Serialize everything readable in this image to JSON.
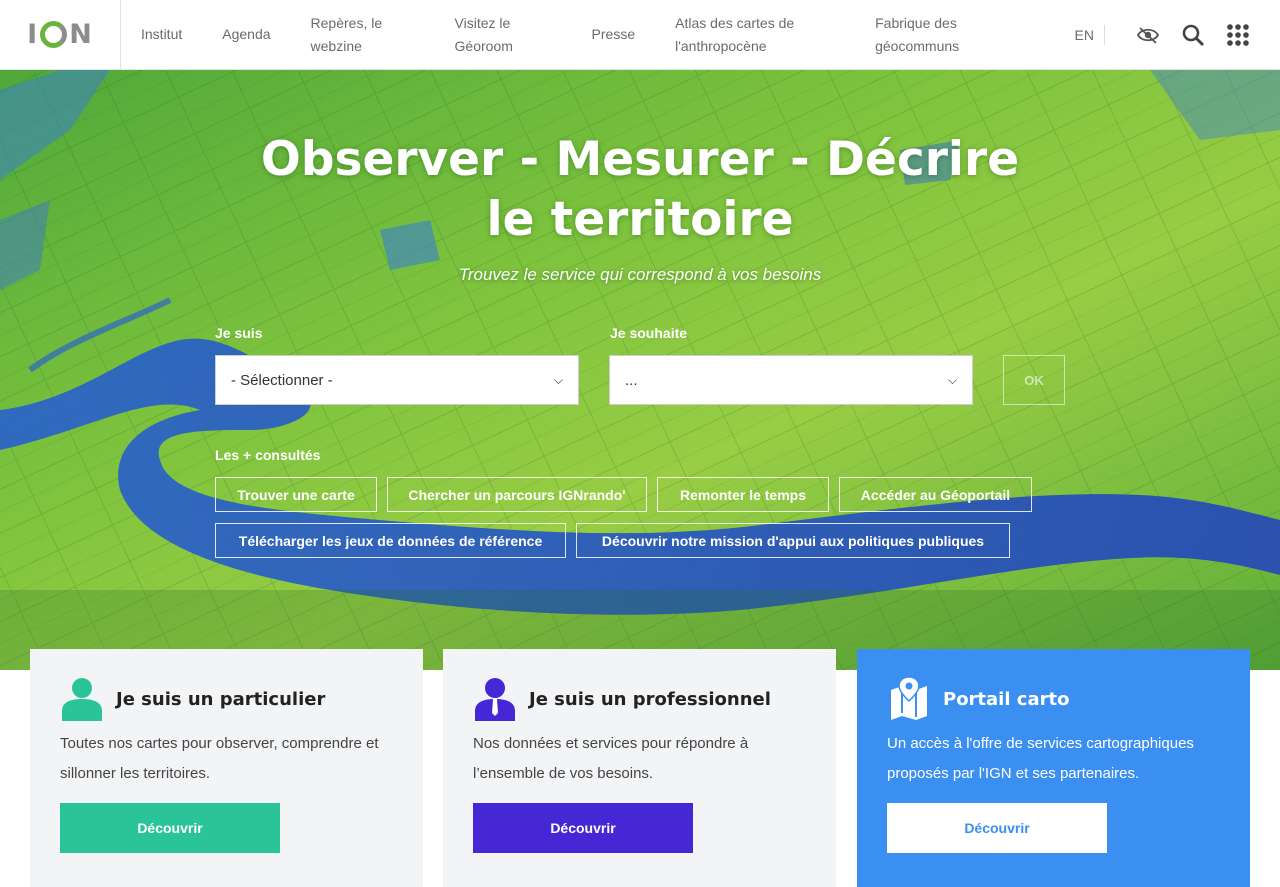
{
  "header": {
    "logo_text": "IGN",
    "nav": [
      {
        "label": "Institut"
      },
      {
        "label": "Agenda"
      },
      {
        "label": "Repères, le webzine"
      },
      {
        "label": "Visitez le Géoroom"
      },
      {
        "label": "Presse"
      },
      {
        "label": "Atlas des cartes de l'anthropocène"
      },
      {
        "label": "Fabrique des géocommuns"
      }
    ],
    "lang": "EN",
    "icons": [
      "accessibility-eye-icon",
      "search-icon",
      "apps-grid-icon"
    ]
  },
  "hero": {
    "title_line1": "Observer - Mesurer - Décrire",
    "title_line2": "le territoire",
    "subtitle": "Trouvez le service qui correspond à vos besoins",
    "form": {
      "je_suis_label": "Je suis",
      "je_suis_value": "- Sélectionner -",
      "je_souhaite_label": "Je souhaite",
      "je_souhaite_value": "...",
      "ok_label": "OK"
    },
    "popular": {
      "label": "Les + consultés",
      "chips": [
        "Trouver une carte",
        "Chercher un parcours IGNrando'",
        "Remonter le temps",
        "Accéder au Géoportail",
        "Télécharger les jeux de données de référence",
        "Découvrir notre mission d'appui aux politiques publiques"
      ]
    }
  },
  "cards": [
    {
      "title": "Je suis un particulier",
      "text": "Toutes nos cartes pour observer, comprendre et sillonner les territoires.",
      "button": "Découvrir",
      "accent": "#2bc498",
      "icon": "person-icon"
    },
    {
      "title": "Je suis un professionnel",
      "text": "Nos données et services pour répondre à l’ensemble de vos besoins.",
      "button": "Découvrir",
      "accent": "#4527d6",
      "icon": "professional-person-icon"
    },
    {
      "title": "Portail carto",
      "text": "Un accès à l'offre de services cartographiques proposés par l'IGN et ses partenaires.",
      "button": "Découvrir",
      "accent": "#3b8ff0",
      "icon": "map-pin-icon"
    }
  ],
  "colors": {
    "nav_text": "#6b6b6b",
    "card_bg": "#f3f4f6",
    "portail_bg": "#3b8ff0",
    "particulier": "#2bc498",
    "professionnel": "#4527d6"
  }
}
